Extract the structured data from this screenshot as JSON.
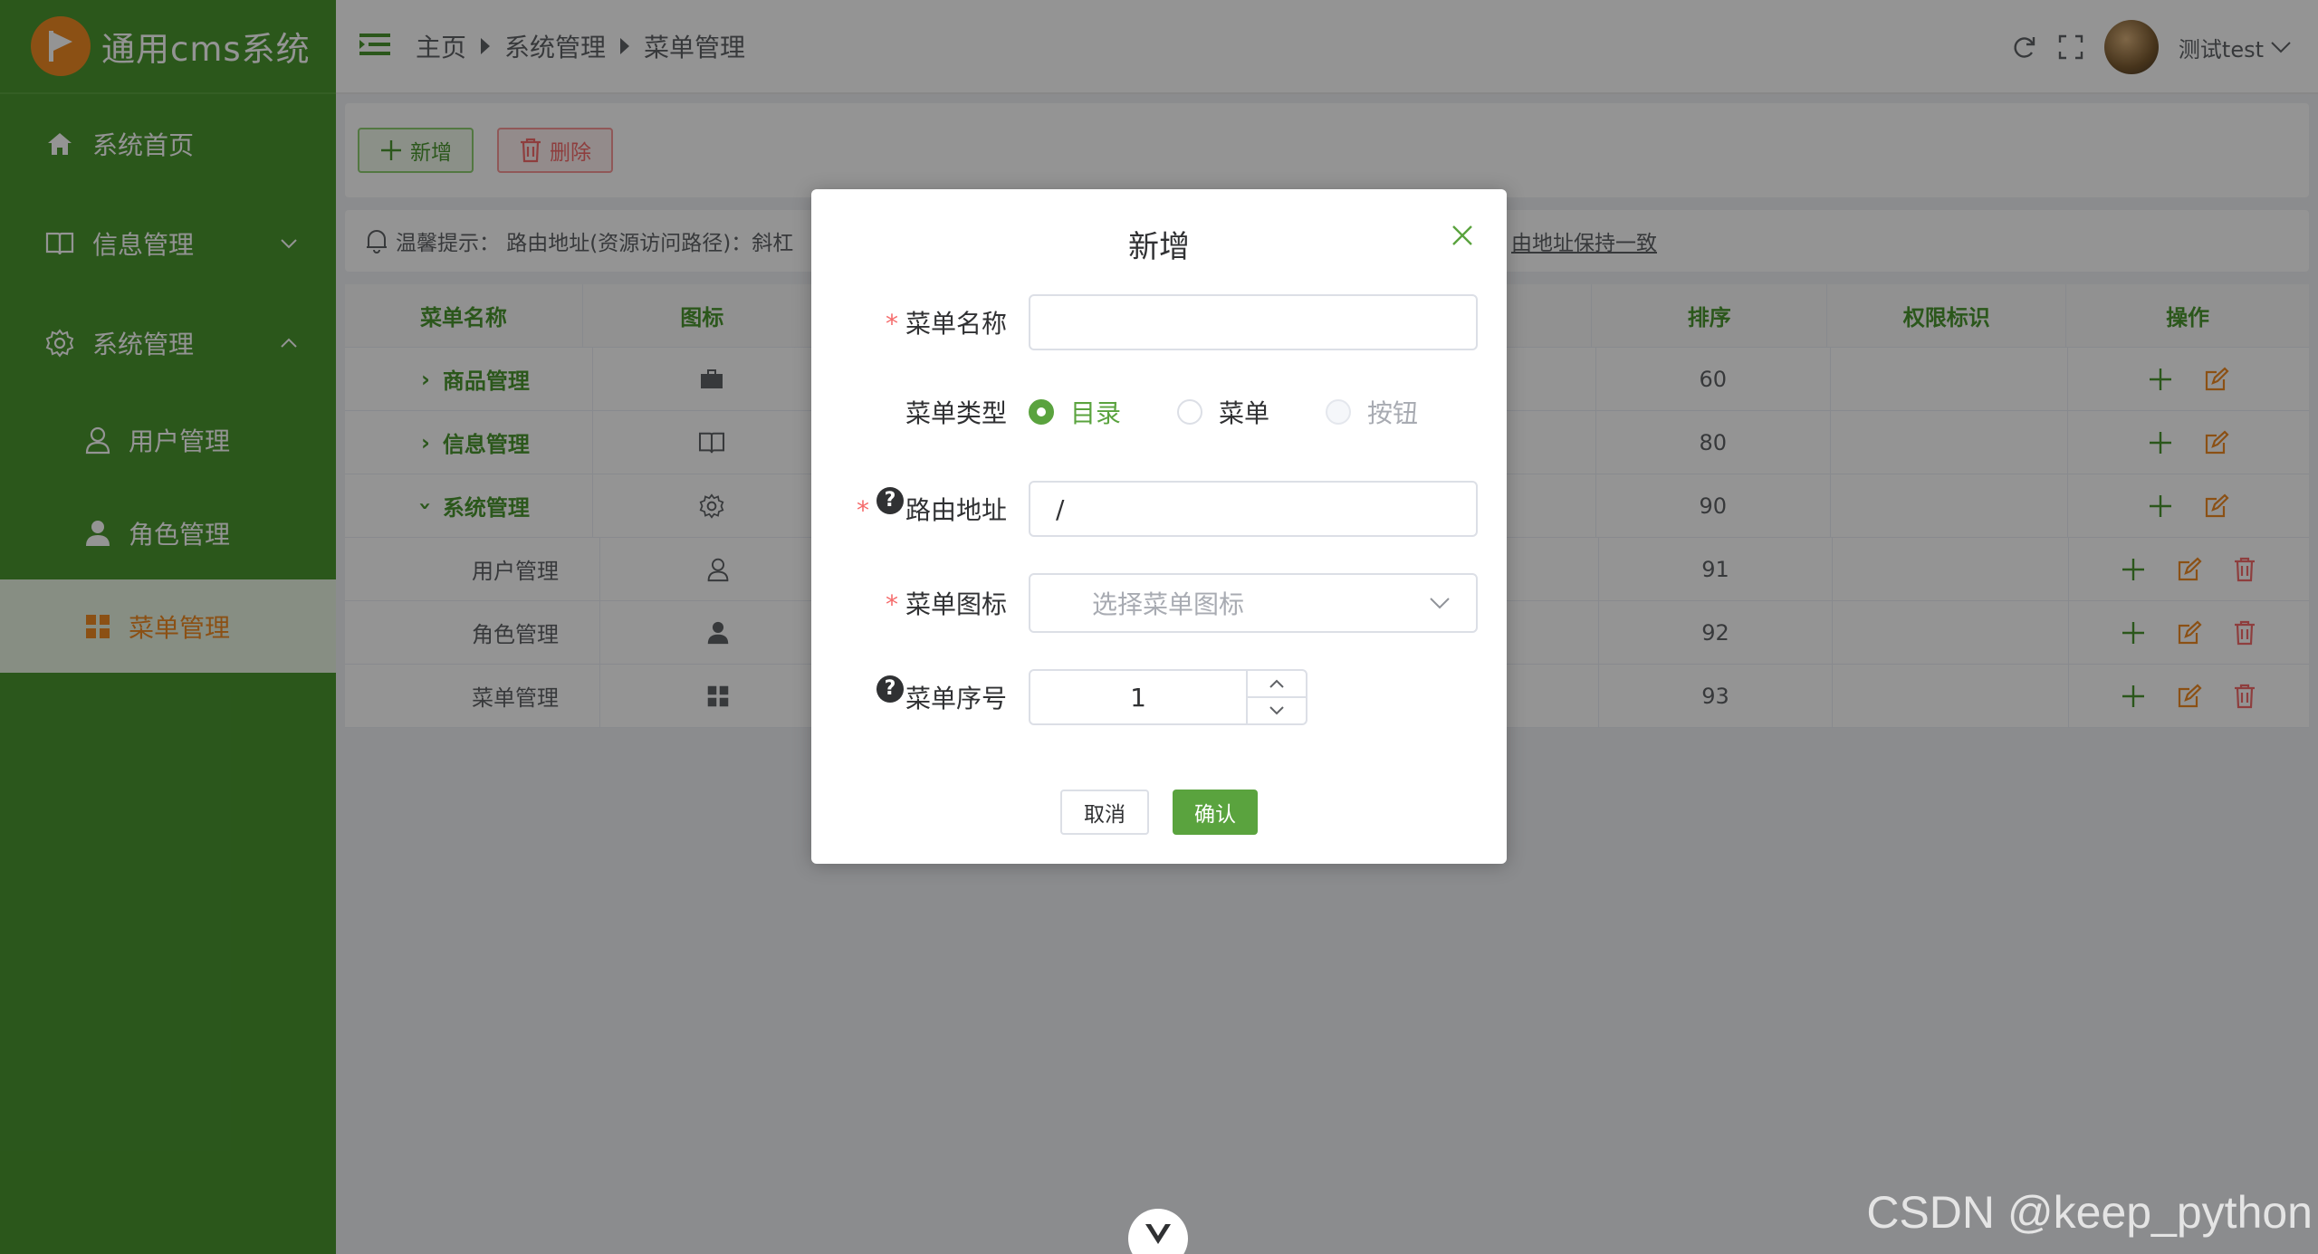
{
  "app": {
    "title": "通用cms系统"
  },
  "sidebar": {
    "items": [
      {
        "label": "系统首页"
      },
      {
        "label": "信息管理"
      },
      {
        "label": "系统管理"
      }
    ],
    "sub_items": [
      {
        "label": "用户管理"
      },
      {
        "label": "角色管理"
      },
      {
        "label": "菜单管理"
      }
    ]
  },
  "header": {
    "breadcrumb": [
      "主页",
      "系统管理",
      "菜单管理"
    ],
    "user": "测试test"
  },
  "toolbar": {
    "add_label": "新增",
    "delete_label": "删除"
  },
  "tip": {
    "text": "温馨提示： 路由地址(资源访问路径)：斜杠",
    "text_end": "由地址保持一致"
  },
  "table": {
    "headers": [
      "菜单名称",
      "图标",
      "排序",
      "权限标识",
      "操作"
    ],
    "rows": [
      {
        "name": "商品管理",
        "order": "60"
      },
      {
        "name": "信息管理",
        "order": "80"
      },
      {
        "name": "系统管理",
        "order": "90"
      },
      {
        "name": "用户管理",
        "order": "91"
      },
      {
        "name": "角色管理",
        "order": "92"
      },
      {
        "name": "菜单管理",
        "order": "93"
      }
    ]
  },
  "dialog": {
    "title": "新增",
    "fields": {
      "name_label": "菜单名称",
      "type_label": "菜单类型",
      "type_options": [
        "目录",
        "菜单",
        "按钮"
      ],
      "type_selected": "目录",
      "path_label": "路由地址",
      "path_value": "/",
      "icon_label": "菜单图标",
      "icon_placeholder": "选择菜单图标",
      "order_label": "菜单序号",
      "order_value": "1"
    },
    "cancel_label": "取消",
    "confirm_label": "确认"
  },
  "watermark": "CSDN @keep_python",
  "colors": {
    "primary": "#4a9630",
    "accent": "#f08a24",
    "danger": "#f56c6c"
  }
}
